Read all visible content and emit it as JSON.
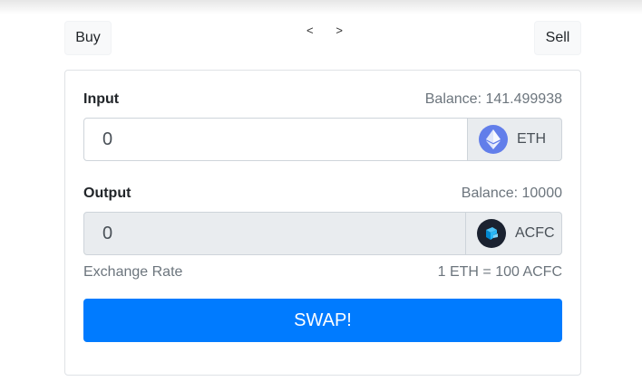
{
  "header": {
    "buy_label": "Buy",
    "sell_label": "Sell",
    "prev_label": "<",
    "next_label": ">"
  },
  "input": {
    "label": "Input",
    "balance": "Balance: 141.499938",
    "value": "0",
    "token": "ETH",
    "token_icon": "ethereum-icon"
  },
  "output": {
    "label": "Output",
    "balance": "Balance: 10000",
    "value": "0",
    "token": "ACFC",
    "token_icon": "acfc-token-icon"
  },
  "exchange": {
    "label": "Exchange Rate",
    "rate": "1 ETH = 100 ACFC"
  },
  "swap_label": "SWAP!",
  "colors": {
    "primary": "#007bff",
    "eth": "#627eea",
    "acfc_bg": "#1b2230",
    "acfc_accent": "#29b6f6"
  }
}
